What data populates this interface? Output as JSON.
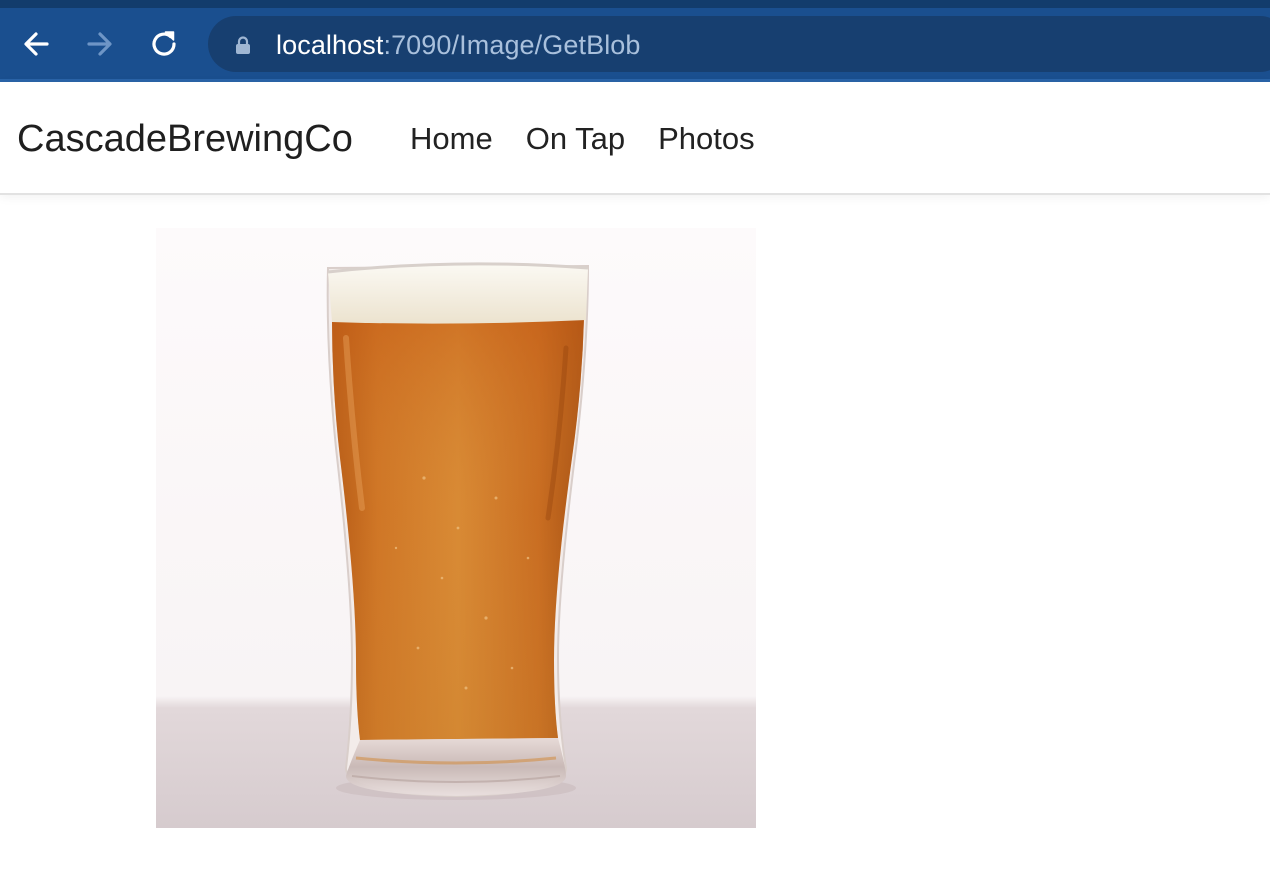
{
  "browser": {
    "url_host": "localhost",
    "url_path": ":7090/Image/GetBlob",
    "icons": {
      "back": "arrow-left-icon",
      "forward": "arrow-right-icon",
      "reload": "reload-icon",
      "lock": "lock-icon"
    },
    "colors": {
      "chrome": "#1a4f8f",
      "omnibox": "#173f70",
      "url_host": "#ffffff",
      "url_path": "#a9c0dc"
    }
  },
  "navbar": {
    "brand": "CascadeBrewingCo",
    "links": [
      {
        "label": "Home"
      },
      {
        "label": "On Tap"
      },
      {
        "label": "Photos"
      }
    ]
  },
  "main": {
    "image": {
      "subject": "beer-glass-photo",
      "colors": {
        "beer": "#c56a1b",
        "foam": "#f6f1e4",
        "surface": "#ddd4d6"
      }
    }
  }
}
